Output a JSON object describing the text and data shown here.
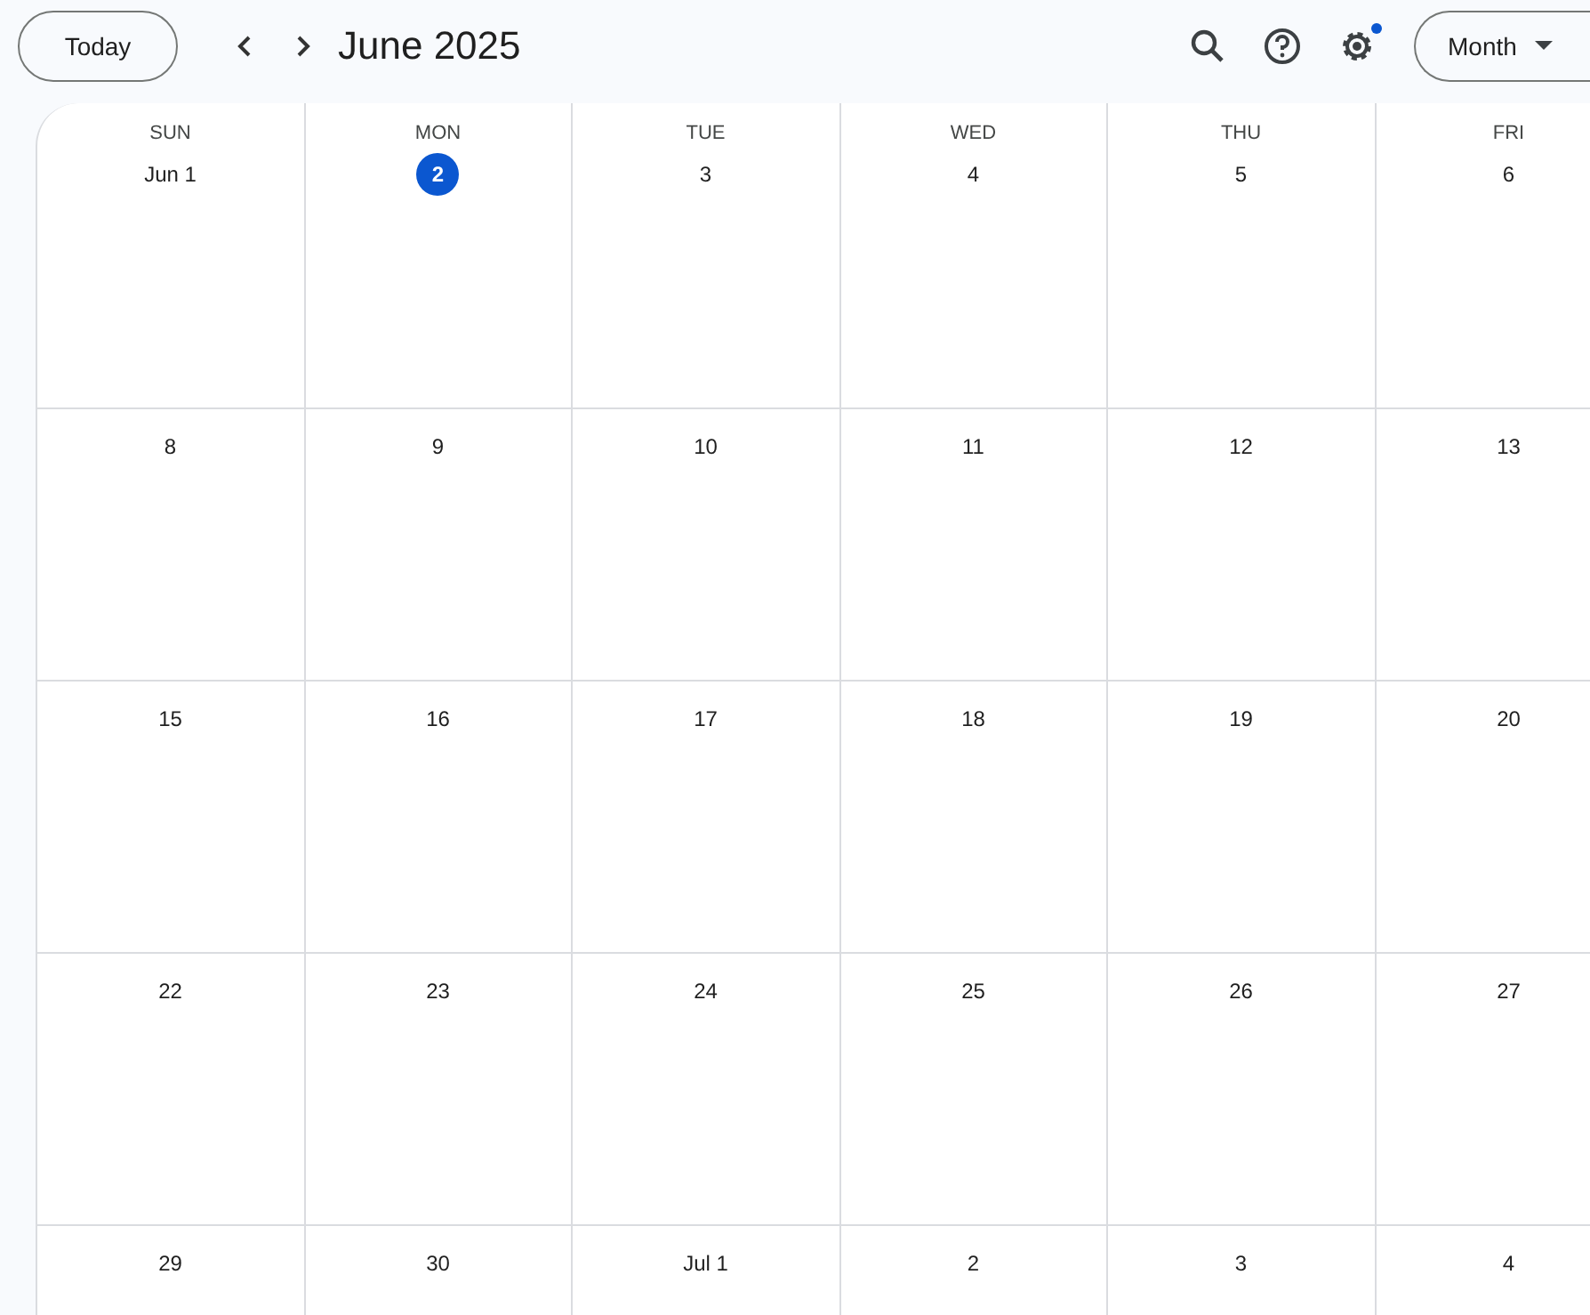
{
  "toolbar": {
    "today_button": "Today",
    "title": "June 2025",
    "settings_notification": true,
    "view_button": "Month"
  },
  "weekdays": [
    "SUN",
    "MON",
    "TUE",
    "WED",
    "THU",
    "FRI"
  ],
  "weeks": [
    [
      {
        "label": "Jun 1",
        "today": false
      },
      {
        "label": "2",
        "today": true
      },
      {
        "label": "3",
        "today": false
      },
      {
        "label": "4",
        "today": false
      },
      {
        "label": "5",
        "today": false
      },
      {
        "label": "6",
        "today": false
      }
    ],
    [
      {
        "label": "8",
        "today": false
      },
      {
        "label": "9",
        "today": false
      },
      {
        "label": "10",
        "today": false
      },
      {
        "label": "11",
        "today": false
      },
      {
        "label": "12",
        "today": false
      },
      {
        "label": "13",
        "today": false
      }
    ],
    [
      {
        "label": "15",
        "today": false
      },
      {
        "label": "16",
        "today": false
      },
      {
        "label": "17",
        "today": false
      },
      {
        "label": "18",
        "today": false
      },
      {
        "label": "19",
        "today": false
      },
      {
        "label": "20",
        "today": false
      }
    ],
    [
      {
        "label": "22",
        "today": false
      },
      {
        "label": "23",
        "today": false
      },
      {
        "label": "24",
        "today": false
      },
      {
        "label": "25",
        "today": false
      },
      {
        "label": "26",
        "today": false
      },
      {
        "label": "27",
        "today": false
      }
    ],
    [
      {
        "label": "29",
        "today": false
      },
      {
        "label": "30",
        "today": false
      },
      {
        "label": "Jul 1",
        "today": false
      },
      {
        "label": "2",
        "today": false
      },
      {
        "label": "3",
        "today": false
      },
      {
        "label": "4",
        "today": false
      }
    ]
  ]
}
